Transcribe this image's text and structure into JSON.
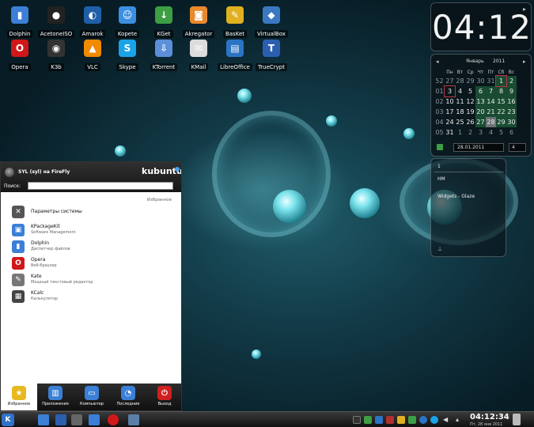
{
  "desktop_icons": [
    {
      "label": "Dolphin",
      "icon": "dolphin-icon",
      "color": "#3b7fd6",
      "glyph": "▮"
    },
    {
      "label": "AcetoneISO",
      "icon": "acetoneiso-icon",
      "color": "#222222",
      "glyph": "●"
    },
    {
      "label": "Amarok",
      "icon": "amarok-icon",
      "color": "#1f5fa8",
      "glyph": "◐"
    },
    {
      "label": "Kopete",
      "icon": "kopete-icon",
      "color": "#3b8fe0",
      "glyph": "☺"
    },
    {
      "label": "KGet",
      "icon": "kget-icon",
      "color": "#3e9e43",
      "glyph": "↓"
    },
    {
      "label": "Akregator",
      "icon": "akregator-icon",
      "color": "#e8892b",
      "glyph": "◙"
    },
    {
      "label": "BasKet",
      "icon": "basket-icon",
      "color": "#e0b020",
      "glyph": "✎"
    },
    {
      "label": "VirtualBox",
      "icon": "virtualbox-icon",
      "color": "#3a78c2",
      "glyph": "◆"
    },
    {
      "label": "Opera",
      "icon": "opera-icon",
      "color": "#d01818",
      "glyph": "O"
    },
    {
      "label": "K3b",
      "icon": "k3b-icon",
      "color": "#333333",
      "glyph": "◉"
    },
    {
      "label": "VLC",
      "icon": "vlc-icon",
      "color": "#f08a00",
      "glyph": "▲"
    },
    {
      "label": "Skype",
      "icon": "skype-icon",
      "color": "#1aa3e8",
      "glyph": "S"
    },
    {
      "label": "KTorrent",
      "icon": "ktorrent-icon",
      "color": "#5b8fd9",
      "glyph": "⇩"
    },
    {
      "label": "KMail",
      "icon": "kmail-icon",
      "color": "#dcdcdc",
      "glyph": "✉"
    },
    {
      "label": "LibreOffice",
      "icon": "libreoffice-icon",
      "color": "#2b74c4",
      "glyph": "▤"
    },
    {
      "label": "TrueCrypt",
      "icon": "truecrypt-icon",
      "color": "#2a5fb0",
      "glyph": "T"
    }
  ],
  "clock": {
    "time": "04:12"
  },
  "calendar": {
    "month": "Январь",
    "year": "2011",
    "weekdays": [
      "Пн",
      "Вт",
      "Ср",
      "Чт",
      "Пт",
      "Сб",
      "Вс"
    ],
    "weeks": [
      {
        "wk": "52",
        "days": [
          "27",
          "28",
          "29",
          "30",
          "31",
          "1",
          "2"
        ]
      },
      {
        "wk": "01",
        "days": [
          "3",
          "4",
          "5",
          "6",
          "7",
          "8",
          "9"
        ]
      },
      {
        "wk": "02",
        "days": [
          "10",
          "11",
          "12",
          "13",
          "14",
          "15",
          "16"
        ]
      },
      {
        "wk": "03",
        "days": [
          "17",
          "18",
          "19",
          "20",
          "21",
          "22",
          "23"
        ]
      },
      {
        "wk": "04",
        "days": [
          "24",
          "25",
          "26",
          "27",
          "28",
          "29",
          "30"
        ]
      },
      {
        "wk": "05",
        "days": [
          "31",
          "1",
          "2",
          "3",
          "4",
          "5",
          "6"
        ]
      }
    ],
    "date_field": "28.01.2011",
    "week_field": "4"
  },
  "folder_widget": {
    "rows": [
      "1",
      "НМ",
      "Widgets - Glaze"
    ]
  },
  "menu": {
    "user": "SYL (syl) на FireFly",
    "brand": "kubuntu",
    "search_label": "Поиск:",
    "search_value": "",
    "section": "Избранное",
    "items": [
      {
        "title": "Параметры системы",
        "subtitle": "",
        "icon": "system-settings-icon",
        "color": "#555555",
        "glyph": "✕"
      },
      {
        "title": "KPackageKit",
        "subtitle": "Software Management",
        "icon": "kpackagekit-icon",
        "color": "#3b7fd6",
        "glyph": "▣"
      },
      {
        "title": "Dolphin",
        "subtitle": "Диспетчер файлов",
        "icon": "dolphin-icon",
        "color": "#3b7fd6",
        "glyph": "▮"
      },
      {
        "title": "Opera",
        "subtitle": "Веб-браузер",
        "icon": "opera-icon",
        "color": "#d01818",
        "glyph": "O"
      },
      {
        "title": "Kate",
        "subtitle": "Мощный текстовый редактор",
        "icon": "kate-icon",
        "color": "#777777",
        "glyph": "✎"
      },
      {
        "title": "KCalc",
        "subtitle": "Калькулятор",
        "icon": "kcalc-icon",
        "color": "#444444",
        "glyph": "▦"
      }
    ],
    "tabs": [
      {
        "label": "Избранное",
        "icon": "star-icon",
        "color": "#e8b820",
        "glyph": "★"
      },
      {
        "label": "Приложения",
        "icon": "applications-icon",
        "color": "#3b7fd6",
        "glyph": "▥"
      },
      {
        "label": "Компьютер",
        "icon": "computer-icon",
        "color": "#3b7fd6",
        "glyph": "▭"
      },
      {
        "label": "Последние",
        "icon": "recent-icon",
        "color": "#3b7fd6",
        "glyph": "◔"
      },
      {
        "label": "Выход",
        "icon": "power-icon",
        "color": "#d02020",
        "glyph": "⏻"
      }
    ]
  },
  "panel": {
    "time": "04:12:34",
    "date": "Пт, 28 янв 2011"
  }
}
